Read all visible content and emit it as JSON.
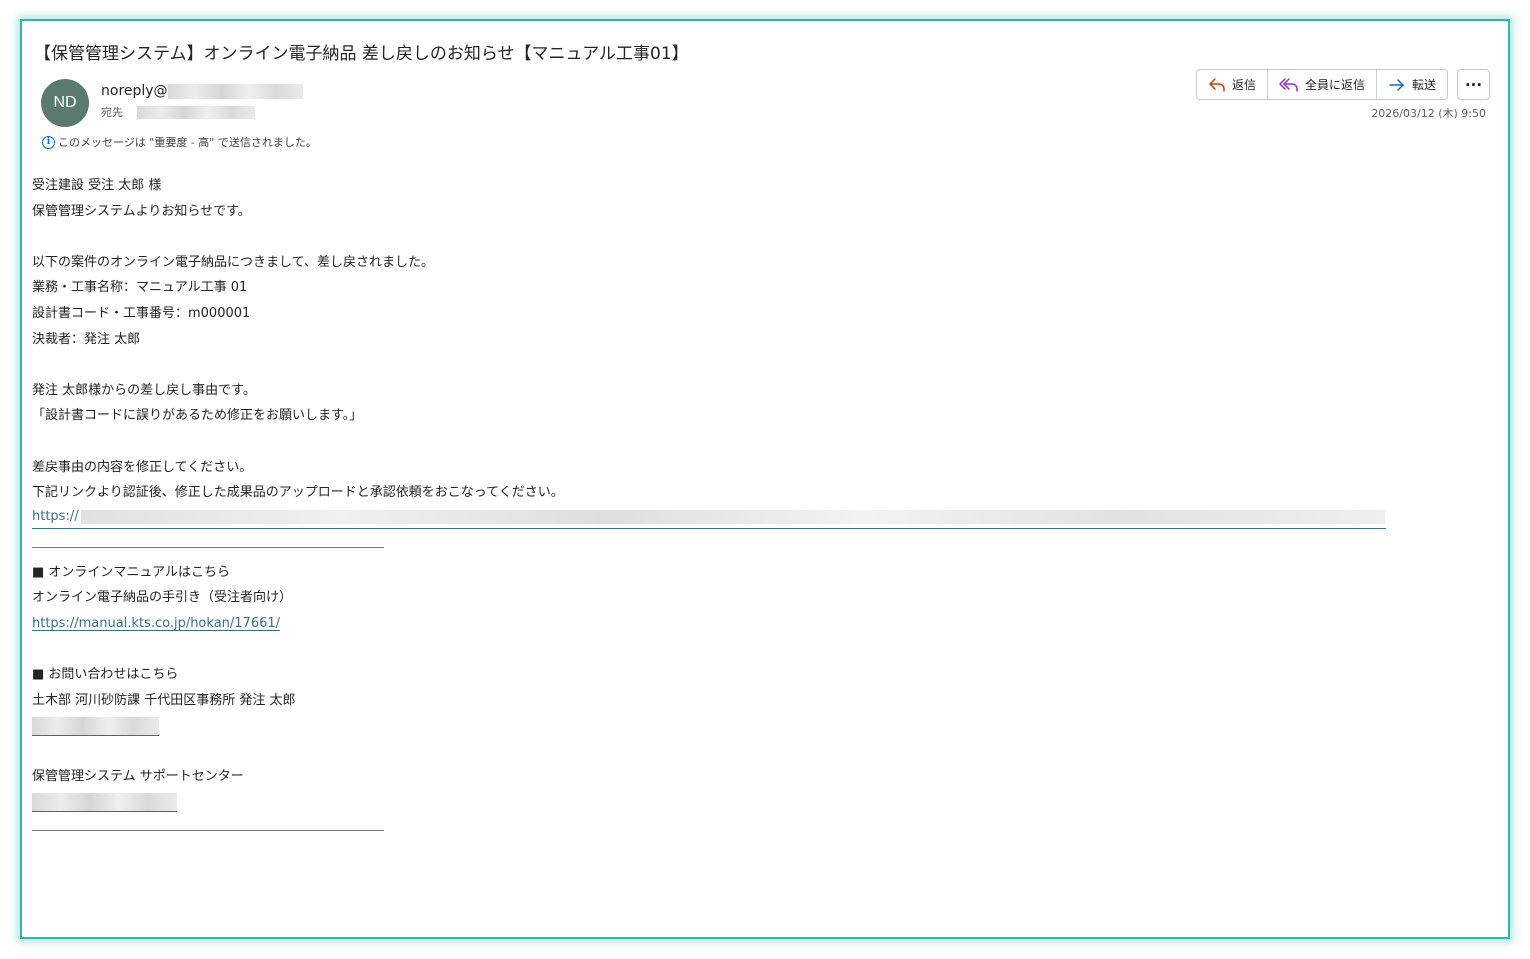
{
  "email": {
    "subject": "【保管管理システム】オンライン電子納品 差し戻しのお知らせ【マニュアル工事01】",
    "sender_initials": "ND",
    "sender_prefix": "noreply@",
    "to_label": "宛先",
    "importance_notice": "このメッセージは \"重要度 - 高\" で送信されました。",
    "date": "2026/03/12 (木) 9:50",
    "avatar_color": "#5a7a70"
  },
  "toolbar": {
    "reply_label": "返信",
    "reply_all_label": "全員に返信",
    "forward_label": "転送",
    "more_label": "···"
  },
  "body": {
    "greeting": "受注建設 受注 太郎 様",
    "intro": "保管管理システムよりお知らせです。",
    "notice": "以下の案件のオンライン電子納品につきまして、差し戻されました。",
    "project_name": "業務・工事名称：マニュアル工事 01",
    "design_code": "設計書コード・工事番号：m000001",
    "approver": "決裁者：発注 太郎",
    "reason_intro": "発注 太郎様からの差し戻し事由です。",
    "reason": "「設計書コードに誤りがあるため修正をお願いします。」",
    "fix_request": "差戻事由の内容を修正してください。",
    "upload_request": "下記リンクより認証後、修正した成果品のアップロードと承認依頼をおこなってください。",
    "link_prefix": "https://",
    "manual_heading": "■ オンラインマニュアルはこちら",
    "manual_title": "オンライン電子納品の手引き（受注者向け）",
    "manual_url": "https://manual.kts.co.jp/hokan/17661/",
    "contact_heading": "■ お問い合わせはこちら",
    "contact_name": "土木部 河川砂防課 千代田区事務所 発注 太郎",
    "support_name": "保管管理システム サポートセンター"
  },
  "colors": {
    "frame_border": "#2ab7b2",
    "link": "#3a6f88",
    "reply_icon": "#c2410c",
    "reply_all_icon": "#9b30c2",
    "forward_icon": "#0f6cbd"
  }
}
